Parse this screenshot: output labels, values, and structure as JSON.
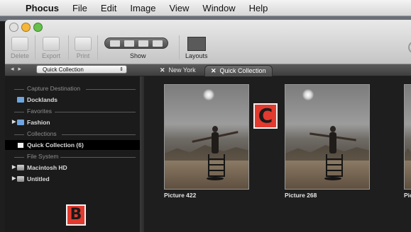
{
  "menubar": {
    "app_name": "Phocus",
    "items": [
      "File",
      "Edit",
      "Image",
      "View",
      "Window",
      "Help"
    ]
  },
  "toolbar": {
    "delete_label": "Delete",
    "export_label": "Export",
    "print_label": "Print",
    "show_label": "Show",
    "layouts_label": "Layouts"
  },
  "tabbar": {
    "collection_select": "Quick Collection",
    "tabs": [
      {
        "label": "New York",
        "active": false
      },
      {
        "label": "Quick Collection",
        "active": true
      }
    ]
  },
  "sidebar": {
    "sections": [
      {
        "title": "Capture Destination"
      },
      {
        "title": "Favorites"
      },
      {
        "title": "Collections"
      },
      {
        "title": "File System"
      }
    ],
    "items": [
      {
        "label": "Docklands",
        "icon": "folder-icon"
      },
      {
        "label": "Fashion",
        "icon": "folder-icon"
      },
      {
        "label": "Quick Collection (6)",
        "icon": "collection-icon",
        "selected": true
      },
      {
        "label": "Macintosh HD",
        "icon": "disk-icon"
      },
      {
        "label": "Untitled",
        "icon": "disk-icon"
      }
    ]
  },
  "markers": {
    "sidebar": "B",
    "browser": "C"
  },
  "browser": {
    "thumbnails": [
      {
        "caption": "Picture 422"
      },
      {
        "caption": "Picture 268"
      },
      {
        "caption": "Pict"
      }
    ]
  },
  "colors": {
    "marker_red": "#e23a2f",
    "selection": "#000000",
    "folder_blue": "#6fa6e0"
  }
}
